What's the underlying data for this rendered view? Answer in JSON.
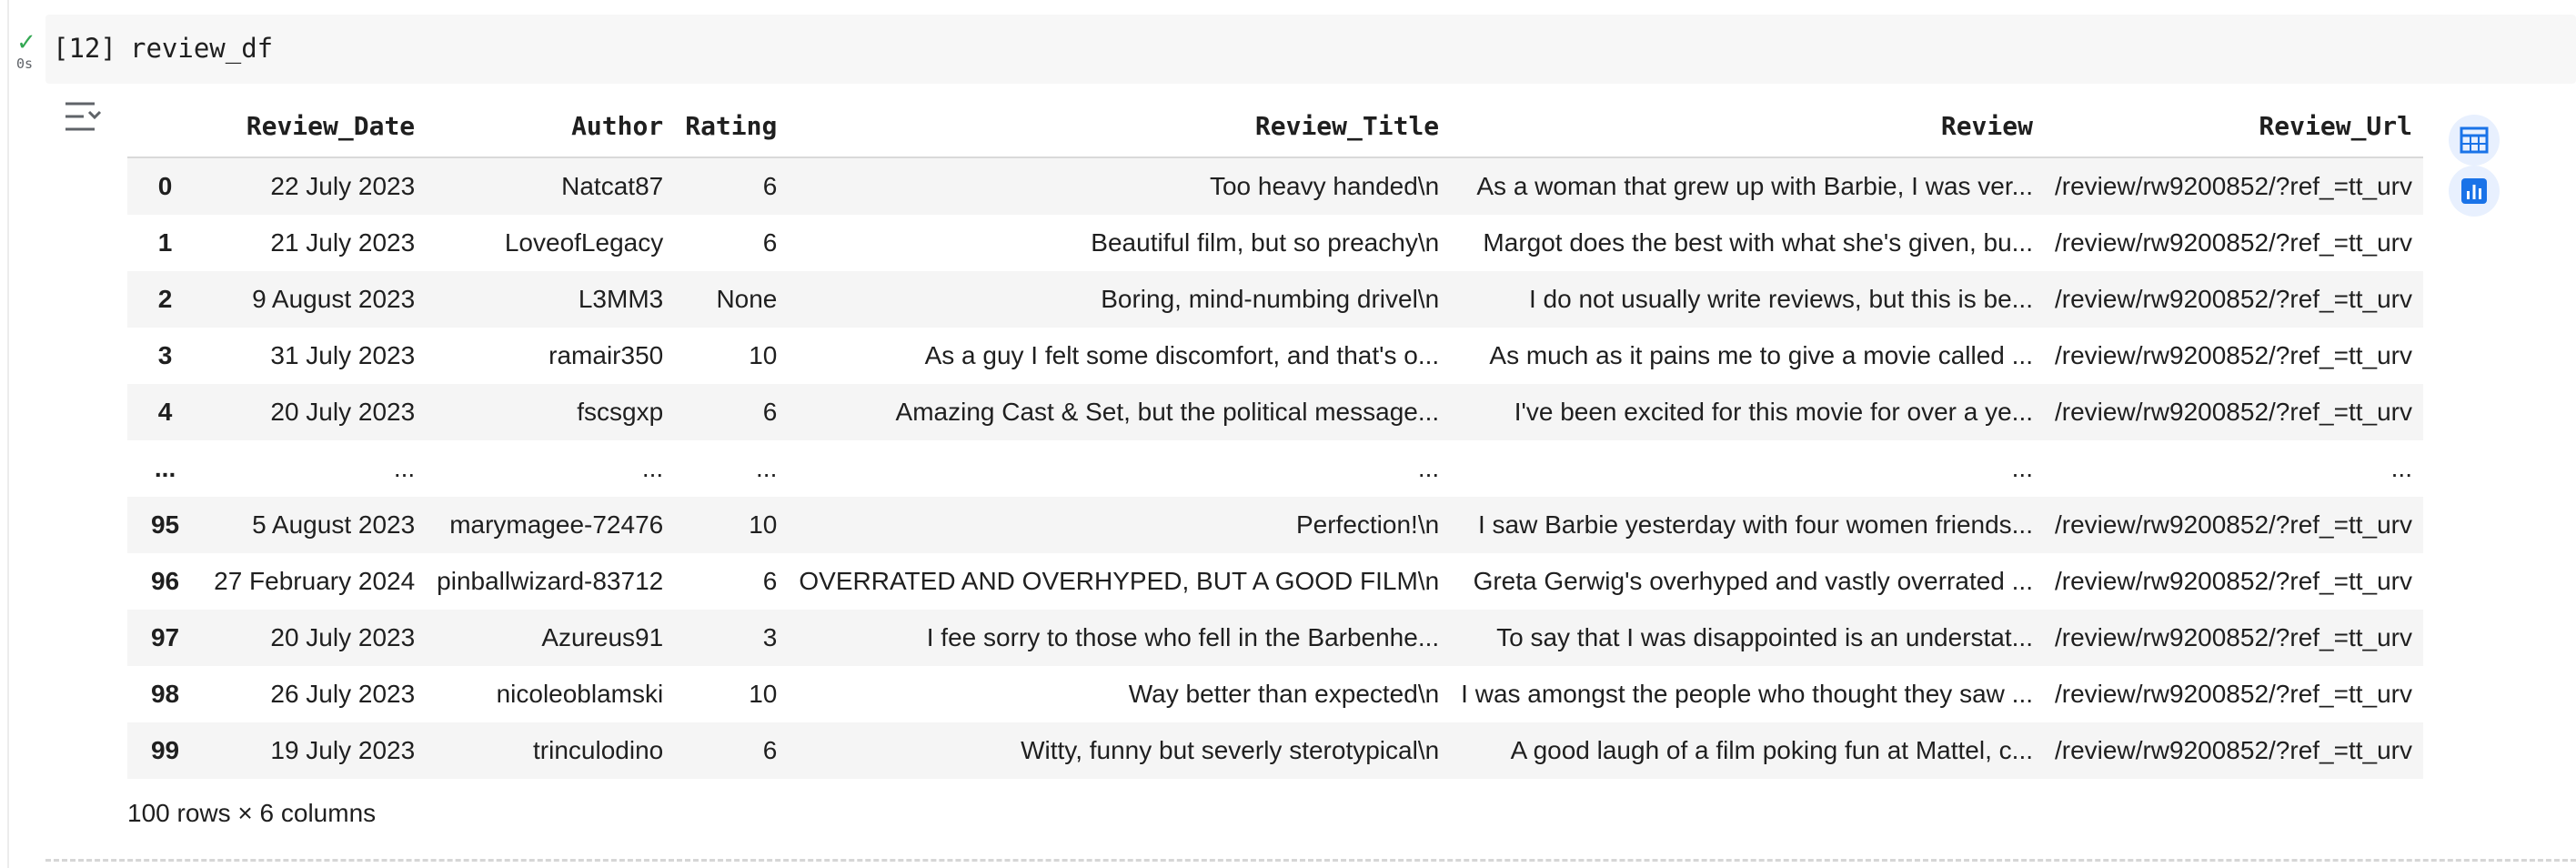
{
  "cell": {
    "status_icon": "check-icon",
    "status_check": "✓",
    "exec_time": "0s",
    "exec_count": "[12]",
    "code": "review_df"
  },
  "table": {
    "columns": [
      "",
      "Review_Date",
      "Author",
      "Rating",
      "Review_Title",
      "Review",
      "Review_Url"
    ],
    "rows": [
      [
        "0",
        "22 July 2023",
        "Natcat87",
        "6",
        "Too heavy handed\\n",
        "As a woman that grew up with Barbie, I was ver...",
        "/review/rw9200852/?ref_=tt_urv"
      ],
      [
        "1",
        "21 July 2023",
        "LoveofLegacy",
        "6",
        "Beautiful film, but so preachy\\n",
        "Margot does the best with what she's given, bu...",
        "/review/rw9200852/?ref_=tt_urv"
      ],
      [
        "2",
        "9 August 2023",
        "L3MM3",
        "None",
        "Boring, mind-numbing drivel\\n",
        "I do not usually write reviews, but this is be...",
        "/review/rw9200852/?ref_=tt_urv"
      ],
      [
        "3",
        "31 July 2023",
        "ramair350",
        "10",
        "As a guy I felt some discomfort, and that's o...",
        "As much as it pains me to give a movie called ...",
        "/review/rw9200852/?ref_=tt_urv"
      ],
      [
        "4",
        "20 July 2023",
        "fscsgxp",
        "6",
        "Amazing Cast & Set, but the political message...",
        "I've been excited for this movie for over a ye...",
        "/review/rw9200852/?ref_=tt_urv"
      ],
      [
        "...",
        "...",
        "...",
        "...",
        "...",
        "...",
        "..."
      ],
      [
        "95",
        "5 August 2023",
        "marymagee-72476",
        "10",
        "Perfection!\\n",
        "I saw Barbie yesterday with four women friends...",
        "/review/rw9200852/?ref_=tt_urv"
      ],
      [
        "96",
        "27 February 2024",
        "pinballwizard-83712",
        "6",
        "OVERRATED AND OVERHYPED, BUT A GOOD FILM\\n",
        "Greta Gerwig's overhyped and vastly overrated ...",
        "/review/rw9200852/?ref_=tt_urv"
      ],
      [
        "97",
        "20 July 2023",
        "Azureus91",
        "3",
        "I fee sorry to those who fell in the Barbenhe...",
        "To say that I was disappointed is an understat...",
        "/review/rw9200852/?ref_=tt_urv"
      ],
      [
        "98",
        "26 July 2023",
        "nicoleoblamski",
        "10",
        "Way better than expected\\n",
        "I was amongst the people who thought they saw ...",
        "/review/rw9200852/?ref_=tt_urv"
      ],
      [
        "99",
        "19 July 2023",
        "trinculodino",
        "6",
        "Witty, funny but severly sterotypical\\n",
        "A good laugh of a film poking fun at Mattel, c...",
        "/review/rw9200852/?ref_=tt_urv"
      ]
    ],
    "footer": "100 rows × 6 columns"
  },
  "side_buttons": {
    "table_icon": "interactive-table-icon",
    "chart_icon": "bar-chart-icon"
  },
  "colors": {
    "accent": "#1a73e8",
    "success": "#34a853",
    "stripe": "#f5f5f5"
  }
}
